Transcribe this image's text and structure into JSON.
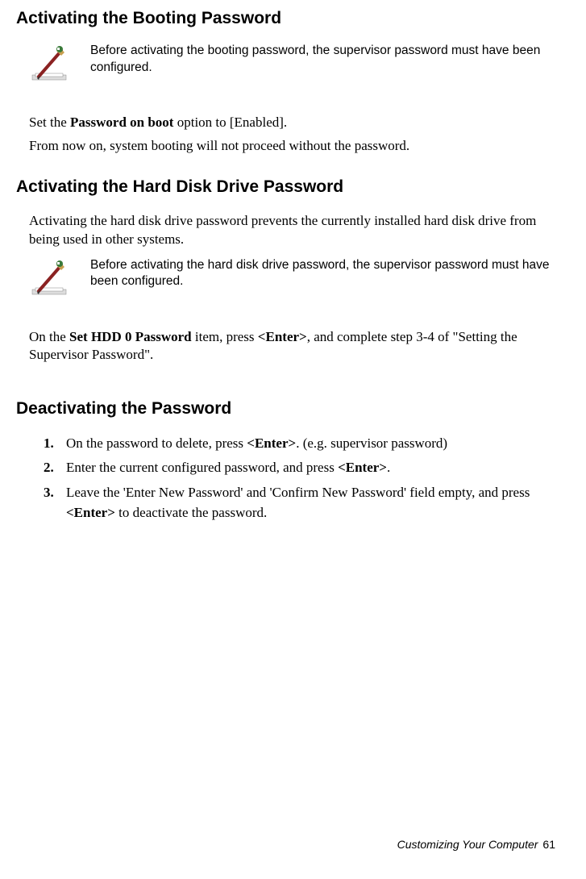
{
  "section1": {
    "heading": "Activating the Booting Password",
    "note": "Before activating the booting password, the supervisor password must have been configured.",
    "p1_a": "Set the ",
    "p1_b": "Password on boot",
    "p1_c": " option to [Enabled].",
    "p2": "From now on, system booting will not proceed without the password."
  },
  "section2": {
    "heading": "Activating the Hard Disk Drive Password",
    "p1": "Activating the hard disk drive password prevents the currently installed hard disk drive from being used in other systems.",
    "note": "Before activating the hard disk drive password, the supervisor password must have been configured.",
    "p2_a": "On the ",
    "p2_b": "Set HDD 0 Password",
    "p2_c": " item, press ",
    "p2_d": "<Enter>",
    "p2_e": ", and complete step 3-4 of \"Setting the Supervisor Password\"."
  },
  "section3": {
    "heading": "Deactivating the Password",
    "steps": [
      {
        "num": "1.",
        "a": "On the password to delete, press ",
        "b": "<Enter>",
        "c": ". (e.g. supervisor password)"
      },
      {
        "num": "2.",
        "a": "Enter the current configured password, and press ",
        "b": "<Enter>",
        "c": "."
      },
      {
        "num": "3.",
        "a": "Leave the 'Enter New Password' and 'Confirm New Password' field empty, and press ",
        "b": "<Enter>",
        "c": " to deactivate the password."
      }
    ]
  },
  "footer": {
    "text": "Customizing Your Computer",
    "page": "61"
  }
}
